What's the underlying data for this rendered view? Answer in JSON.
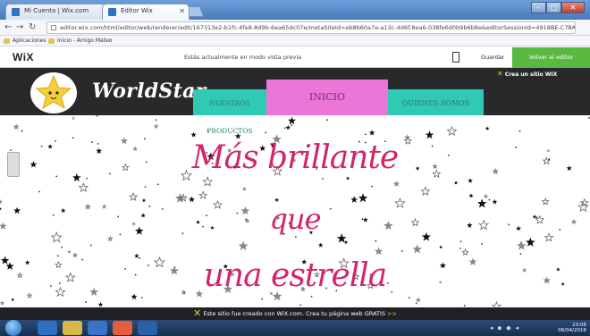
{
  "browser": {
    "tabs": [
      {
        "label": "Mi Cuenta | Wix.com",
        "active": false
      },
      {
        "label": "Editor Wix",
        "active": true
      }
    ],
    "address": "editor.wix.com/html/editor/web/renderer/edit/167313e2-b1fc-4fe8-8d9b-6ea65dc07e/metaSiteId=eb8b60a7e-a13c-4d6f-8ea6-038fe6d0b9b6b8e&editorSessionId=4918BE-C79A-4DAC-8E0C",
    "bookmarks": [
      {
        "label": "Aplicaciones",
        "icon": "apps-icon"
      },
      {
        "label": "Inicio - Amigo Mateo",
        "icon": "folder-icon"
      }
    ]
  },
  "wix": {
    "logo": "WiX",
    "preview_message": "Estás actualmente en modo vista previa",
    "save_label": "Guardar",
    "back_label": "Volver al editor"
  },
  "site": {
    "title": "WorldStar",
    "badge": "Crea un sitio",
    "badge_brand": "WIX",
    "nav": [
      {
        "label": "NUESTROS PRODUCTOS",
        "active": false
      },
      {
        "label": "INICIO",
        "active": true
      },
      {
        "label": "QUIENES SOMOS",
        "active": false
      }
    ],
    "hero_lines": [
      "Más brillante",
      "que",
      "una estrella"
    ]
  },
  "banner": {
    "text": "Este sitio fue creado con WiX.com. Crea tu página web GRATIS",
    "arrow": ">>"
  },
  "taskbar": {
    "time": "23:06",
    "date": "06/04/2016"
  },
  "colors": {
    "accent_green": "#5ab940",
    "nav_teal": "#30c9b3",
    "nav_pink": "#ea76d8",
    "hero_text": "#d4246a"
  }
}
